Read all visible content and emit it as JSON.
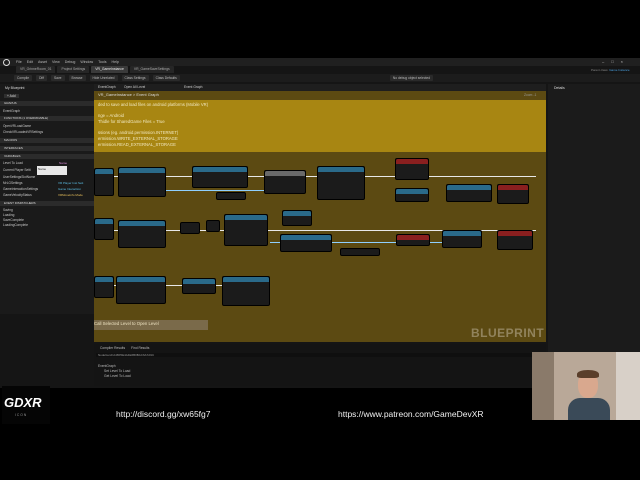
{
  "menu": [
    "File",
    "Edit",
    "Asset",
    "View",
    "Debug",
    "Window",
    "Tools",
    "Help"
  ],
  "tabs": [
    "VR_GrinneRoom_01",
    "Project Settings",
    "VR_GameInstance",
    "VR_GameSaveSettings"
  ],
  "parent_class": "Parent class:",
  "parent_class_value": "Game Instance",
  "toolbar": [
    "Compile",
    "Diff",
    "Save",
    "Browse",
    "Hide Unrelated",
    "Class Settings",
    "Class Defaults"
  ],
  "debug_filter": "No debug object selected",
  "graph_tabs": [
    "EventGraph",
    "Open All Level",
    "Event Graph"
  ],
  "breadcrumb": "VR_GameInstance > Event Graph",
  "zoom": "Zoom -1",
  "details_label": "Details",
  "my_blueprint": {
    "title": "My Blueprint",
    "add_label": "+ Add",
    "sections": [
      "GRAPHS",
      "FUNCTIONS (1 OVERRIDABLE)",
      "MACROS",
      "VARIABLES",
      "EVENT DISPATCHERS"
    ],
    "graphs": [
      "EventGraph"
    ],
    "functions": [
      "OpenVRLoadGame",
      "CheckVRLoadedVRSettings"
    ],
    "interfaces": "INTERFACES",
    "variables": [
      "Level To Load",
      "Current Player Setti",
      "UserSettingsSlotName",
      "MrLGSettings",
      "GameInteractionSettings",
      "GameVelocityStatus"
    ],
    "variable_types": [
      "Name",
      "VR Player Inst Sett",
      "Game Interaction",
      "VRMoveInfo Mode"
    ],
    "tooltip": "Name",
    "dispatchers": [
      "Saving",
      "Loading",
      "SaveComplete",
      "LoadingComplete"
    ]
  },
  "comment_text": [
    "ded to save and load files on android platforms (Mobile VR)",
    "nge = Android",
    "Thidle for SharedGame Files = True",
    "ssions (eg. android.permission.INTERNET)",
    "ermission.WRITE_EXTERNAL_STORAGE",
    "ermission.READ_EXTERNAL_STORAGE"
  ],
  "bottom_comment": "Call Selected Level to Open Level",
  "watermark": "BLUEPRINT",
  "compiler": {
    "tabs": [
      "Compiler Results",
      "Find Results"
    ],
    "search": "NodeGuid=A48F5E4A4E6B0BAC6A7A9C",
    "results": [
      "EventGraph",
      "Set Level To Load",
      "Get Level To Load"
    ]
  },
  "links": {
    "discord": "http://discord.gg/xw65fg7",
    "patreon": "https://www.patreon.com/GameDevXR"
  },
  "logo": {
    "text": "GDXR",
    "sub": "ICON"
  },
  "colors": {
    "graph_bg": "#5c4a12",
    "comment": "#a88612",
    "function_header": "#2a6a8a",
    "event_header": "#8a1f1f",
    "macro_header": "#6a6a6a"
  }
}
